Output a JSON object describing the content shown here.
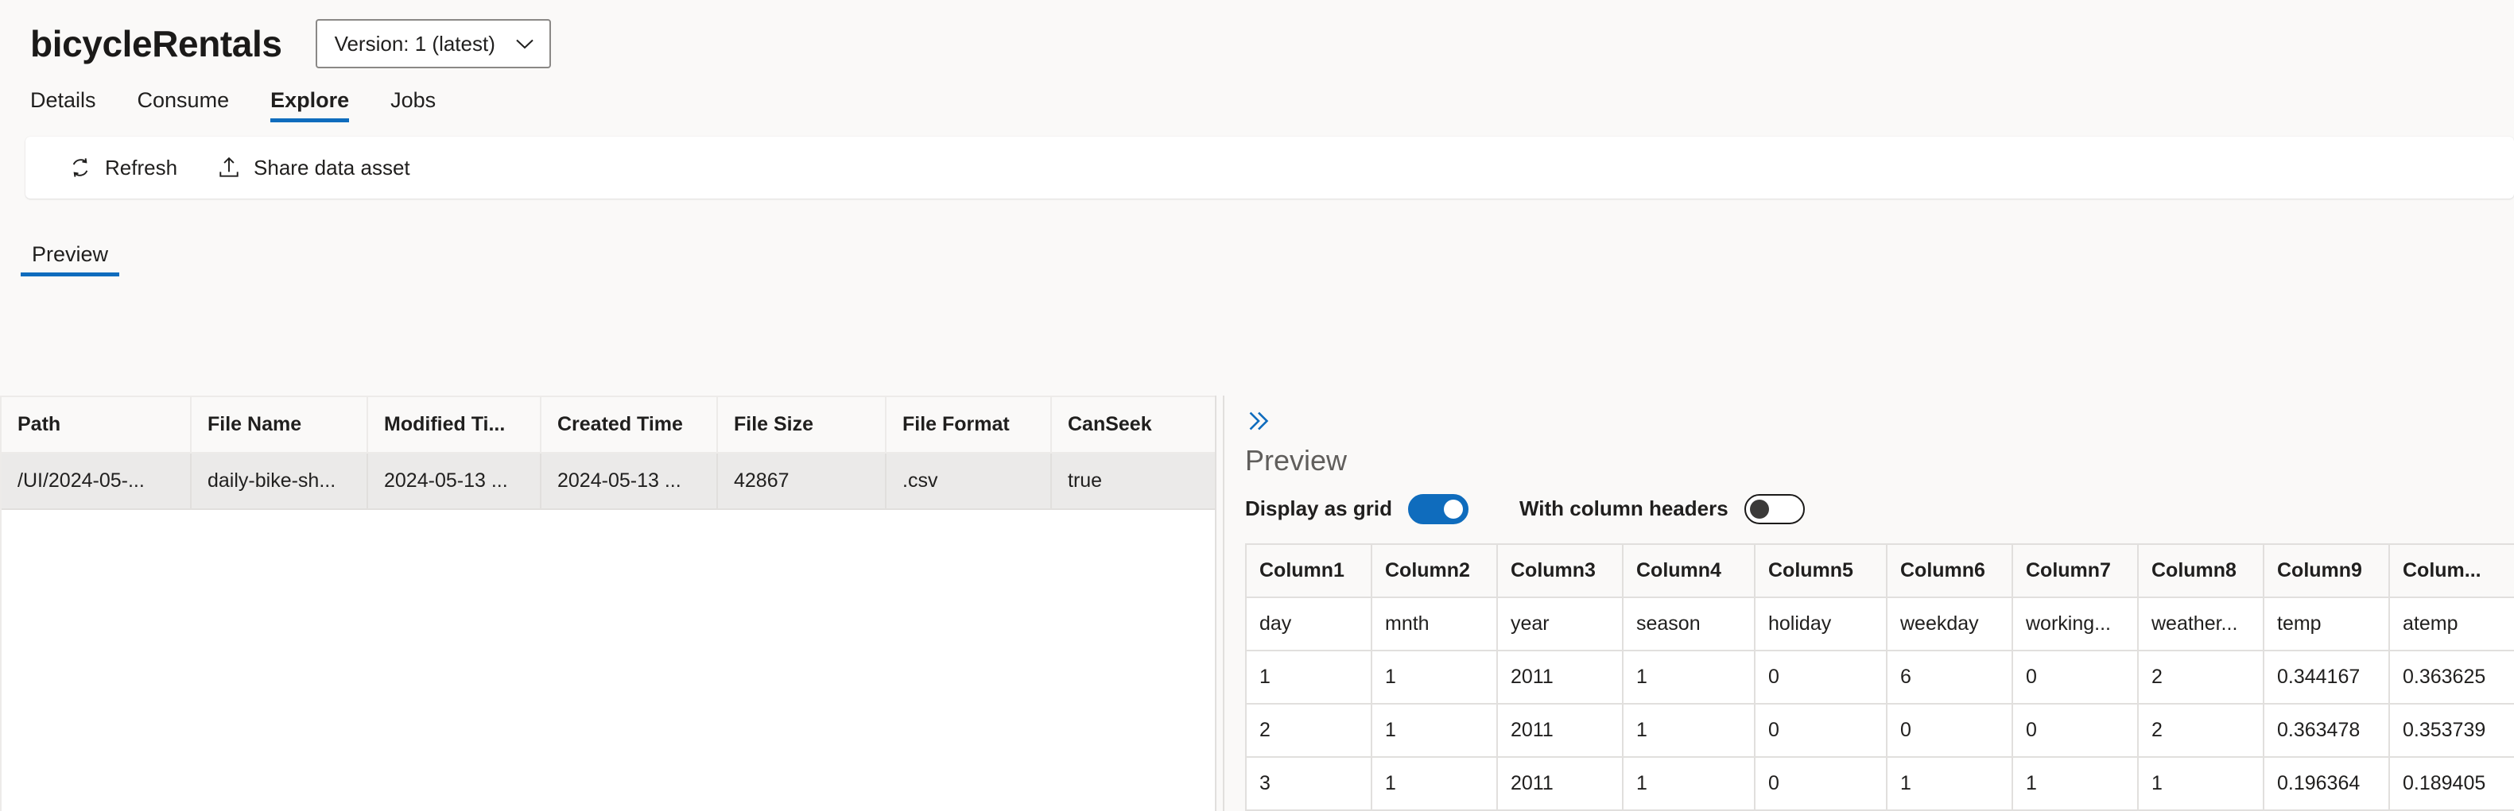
{
  "header": {
    "asset_title": "bicycleRentals",
    "version_label": "Version: 1 (latest)",
    "chevron_icon": "chevron-down-icon"
  },
  "tabs": [
    {
      "label": "Details",
      "active": false
    },
    {
      "label": "Consume",
      "active": false
    },
    {
      "label": "Explore",
      "active": true
    },
    {
      "label": "Jobs",
      "active": false
    }
  ],
  "commandbar": [
    {
      "label": "Refresh",
      "icon": "refresh-icon"
    },
    {
      "label": "Share data asset",
      "icon": "upload-icon"
    }
  ],
  "subtabs": [
    {
      "label": "Preview",
      "active": true
    }
  ],
  "file_table": {
    "columns": [
      "Path",
      "File Name",
      "Modified Ti...",
      "Created Time",
      "File Size",
      "File Format",
      "CanSeek"
    ],
    "rows": [
      [
        "/UI/2024-05-...",
        "daily-bike-sh...",
        "2024-05-13 ...",
        "2024-05-13 ...",
        "42867",
        ".csv",
        "true"
      ]
    ]
  },
  "preview_panel": {
    "expand_icon": "double-chevron-right-icon",
    "heading": "Preview",
    "toggles": [
      {
        "label": "Display as grid",
        "state": "on"
      },
      {
        "label": "With column headers",
        "state": "off"
      }
    ],
    "grid": {
      "columns": [
        "Column1",
        "Column2",
        "Column3",
        "Column4",
        "Column5",
        "Column6",
        "Column7",
        "Column8",
        "Column9",
        "Colum..."
      ],
      "rows": [
        [
          "day",
          "mnth",
          "year",
          "season",
          "holiday",
          "weekday",
          "working...",
          "weather...",
          "temp",
          "atemp"
        ],
        [
          "1",
          "1",
          "2011",
          "1",
          "0",
          "6",
          "0",
          "2",
          "0.344167",
          "0.363625"
        ],
        [
          "2",
          "1",
          "2011",
          "1",
          "0",
          "0",
          "0",
          "2",
          "0.363478",
          "0.353739"
        ],
        [
          "3",
          "1",
          "2011",
          "1",
          "0",
          "1",
          "1",
          "1",
          "0.196364",
          "0.189405"
        ]
      ]
    }
  },
  "colors": {
    "accent": "#0f6cbd",
    "page_bg": "#faf9f8",
    "row_bg": "#ebeae9"
  }
}
